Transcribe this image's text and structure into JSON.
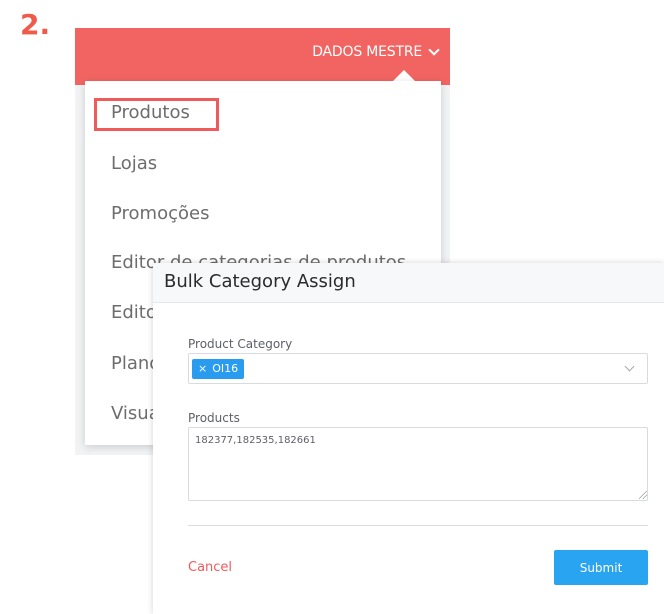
{
  "step": {
    "number": "2."
  },
  "topbar": {
    "menu_label": "DADOS MESTRE",
    "menu_icon": "chevron-down-icon"
  },
  "dropdown": {
    "items": [
      {
        "label": "Produtos",
        "highlighted": true
      },
      {
        "label": "Lojas"
      },
      {
        "label": "Promoções"
      },
      {
        "label": "Editor de categorias de produtos"
      },
      {
        "label": "Editor de categorias de lojas"
      },
      {
        "label": "Planograma"
      },
      {
        "label": "Visualizador"
      }
    ]
  },
  "modal": {
    "title": "Bulk Category Assign",
    "category": {
      "label": "Product Category",
      "tags": [
        {
          "value": "OI16",
          "remove_glyph": "×"
        }
      ]
    },
    "products": {
      "label": "Products",
      "value": "182377,182535,182661"
    },
    "cancel_label": "Cancel",
    "submit_label": "Submit"
  },
  "colors": {
    "accent_red": "#f26461",
    "highlight_red": "#ef5a5a",
    "primary_blue": "#29a4f0",
    "tag_blue": "#2a9cf0"
  }
}
